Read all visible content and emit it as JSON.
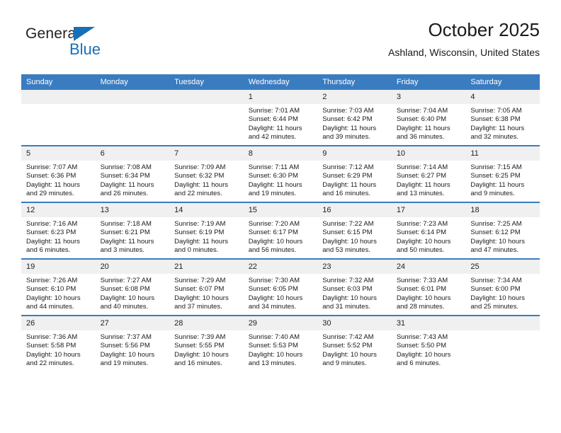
{
  "brand": {
    "name_part1": "General",
    "name_part2": "Blue",
    "accent_color": "#1670b8"
  },
  "header": {
    "title": "October 2025",
    "subtitle": "Ashland, Wisconsin, United States"
  },
  "calendar": {
    "header_bg": "#3a7cc0",
    "daynum_bg": "#f0f0f0",
    "weekday_headers": [
      "Sunday",
      "Monday",
      "Tuesday",
      "Wednesday",
      "Thursday",
      "Friday",
      "Saturday"
    ],
    "labels": {
      "sunrise": "Sunrise:",
      "sunset": "Sunset:",
      "daylight": "Daylight:"
    },
    "weeks": [
      [
        {
          "day": ""
        },
        {
          "day": ""
        },
        {
          "day": ""
        },
        {
          "day": "1",
          "sunrise": "Sunrise: 7:01 AM",
          "sunset": "Sunset: 6:44 PM",
          "daylight": "Daylight: 11 hours and 42 minutes."
        },
        {
          "day": "2",
          "sunrise": "Sunrise: 7:03 AM",
          "sunset": "Sunset: 6:42 PM",
          "daylight": "Daylight: 11 hours and 39 minutes."
        },
        {
          "day": "3",
          "sunrise": "Sunrise: 7:04 AM",
          "sunset": "Sunset: 6:40 PM",
          "daylight": "Daylight: 11 hours and 36 minutes."
        },
        {
          "day": "4",
          "sunrise": "Sunrise: 7:05 AM",
          "sunset": "Sunset: 6:38 PM",
          "daylight": "Daylight: 11 hours and 32 minutes."
        }
      ],
      [
        {
          "day": "5",
          "sunrise": "Sunrise: 7:07 AM",
          "sunset": "Sunset: 6:36 PM",
          "daylight": "Daylight: 11 hours and 29 minutes."
        },
        {
          "day": "6",
          "sunrise": "Sunrise: 7:08 AM",
          "sunset": "Sunset: 6:34 PM",
          "daylight": "Daylight: 11 hours and 26 minutes."
        },
        {
          "day": "7",
          "sunrise": "Sunrise: 7:09 AM",
          "sunset": "Sunset: 6:32 PM",
          "daylight": "Daylight: 11 hours and 22 minutes."
        },
        {
          "day": "8",
          "sunrise": "Sunrise: 7:11 AM",
          "sunset": "Sunset: 6:30 PM",
          "daylight": "Daylight: 11 hours and 19 minutes."
        },
        {
          "day": "9",
          "sunrise": "Sunrise: 7:12 AM",
          "sunset": "Sunset: 6:29 PM",
          "daylight": "Daylight: 11 hours and 16 minutes."
        },
        {
          "day": "10",
          "sunrise": "Sunrise: 7:14 AM",
          "sunset": "Sunset: 6:27 PM",
          "daylight": "Daylight: 11 hours and 13 minutes."
        },
        {
          "day": "11",
          "sunrise": "Sunrise: 7:15 AM",
          "sunset": "Sunset: 6:25 PM",
          "daylight": "Daylight: 11 hours and 9 minutes."
        }
      ],
      [
        {
          "day": "12",
          "sunrise": "Sunrise: 7:16 AM",
          "sunset": "Sunset: 6:23 PM",
          "daylight": "Daylight: 11 hours and 6 minutes."
        },
        {
          "day": "13",
          "sunrise": "Sunrise: 7:18 AM",
          "sunset": "Sunset: 6:21 PM",
          "daylight": "Daylight: 11 hours and 3 minutes."
        },
        {
          "day": "14",
          "sunrise": "Sunrise: 7:19 AM",
          "sunset": "Sunset: 6:19 PM",
          "daylight": "Daylight: 11 hours and 0 minutes."
        },
        {
          "day": "15",
          "sunrise": "Sunrise: 7:20 AM",
          "sunset": "Sunset: 6:17 PM",
          "daylight": "Daylight: 10 hours and 56 minutes."
        },
        {
          "day": "16",
          "sunrise": "Sunrise: 7:22 AM",
          "sunset": "Sunset: 6:15 PM",
          "daylight": "Daylight: 10 hours and 53 minutes."
        },
        {
          "day": "17",
          "sunrise": "Sunrise: 7:23 AM",
          "sunset": "Sunset: 6:14 PM",
          "daylight": "Daylight: 10 hours and 50 minutes."
        },
        {
          "day": "18",
          "sunrise": "Sunrise: 7:25 AM",
          "sunset": "Sunset: 6:12 PM",
          "daylight": "Daylight: 10 hours and 47 minutes."
        }
      ],
      [
        {
          "day": "19",
          "sunrise": "Sunrise: 7:26 AM",
          "sunset": "Sunset: 6:10 PM",
          "daylight": "Daylight: 10 hours and 44 minutes."
        },
        {
          "day": "20",
          "sunrise": "Sunrise: 7:27 AM",
          "sunset": "Sunset: 6:08 PM",
          "daylight": "Daylight: 10 hours and 40 minutes."
        },
        {
          "day": "21",
          "sunrise": "Sunrise: 7:29 AM",
          "sunset": "Sunset: 6:07 PM",
          "daylight": "Daylight: 10 hours and 37 minutes."
        },
        {
          "day": "22",
          "sunrise": "Sunrise: 7:30 AM",
          "sunset": "Sunset: 6:05 PM",
          "daylight": "Daylight: 10 hours and 34 minutes."
        },
        {
          "day": "23",
          "sunrise": "Sunrise: 7:32 AM",
          "sunset": "Sunset: 6:03 PM",
          "daylight": "Daylight: 10 hours and 31 minutes."
        },
        {
          "day": "24",
          "sunrise": "Sunrise: 7:33 AM",
          "sunset": "Sunset: 6:01 PM",
          "daylight": "Daylight: 10 hours and 28 minutes."
        },
        {
          "day": "25",
          "sunrise": "Sunrise: 7:34 AM",
          "sunset": "Sunset: 6:00 PM",
          "daylight": "Daylight: 10 hours and 25 minutes."
        }
      ],
      [
        {
          "day": "26",
          "sunrise": "Sunrise: 7:36 AM",
          "sunset": "Sunset: 5:58 PM",
          "daylight": "Daylight: 10 hours and 22 minutes."
        },
        {
          "day": "27",
          "sunrise": "Sunrise: 7:37 AM",
          "sunset": "Sunset: 5:56 PM",
          "daylight": "Daylight: 10 hours and 19 minutes."
        },
        {
          "day": "28",
          "sunrise": "Sunrise: 7:39 AM",
          "sunset": "Sunset: 5:55 PM",
          "daylight": "Daylight: 10 hours and 16 minutes."
        },
        {
          "day": "29",
          "sunrise": "Sunrise: 7:40 AM",
          "sunset": "Sunset: 5:53 PM",
          "daylight": "Daylight: 10 hours and 13 minutes."
        },
        {
          "day": "30",
          "sunrise": "Sunrise: 7:42 AM",
          "sunset": "Sunset: 5:52 PM",
          "daylight": "Daylight: 10 hours and 9 minutes."
        },
        {
          "day": "31",
          "sunrise": "Sunrise: 7:43 AM",
          "sunset": "Sunset: 5:50 PM",
          "daylight": "Daylight: 10 hours and 6 minutes."
        },
        {
          "day": ""
        }
      ]
    ]
  }
}
